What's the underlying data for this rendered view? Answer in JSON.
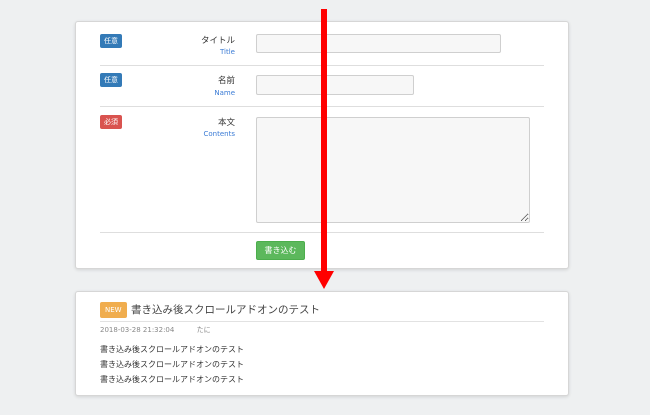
{
  "form": {
    "fields": [
      {
        "badge": "任意",
        "label": "タイトル",
        "label_en": "Title",
        "value": ""
      },
      {
        "badge": "任意",
        "label": "名前",
        "label_en": "Name",
        "value": ""
      },
      {
        "badge": "必須",
        "label": "本文",
        "label_en": "Contents",
        "value": ""
      }
    ],
    "submit_label": "書き込む"
  },
  "post": {
    "badge": "NEW",
    "title": "書き込み後スクロールアドオンのテスト",
    "date": "2018-03-28 21:32:04",
    "author": "たに",
    "lines": [
      "書き込み後スクロールアドオンのテスト",
      "書き込み後スクロールアドオンのテスト",
      "書き込み後スクロールアドオンのテスト"
    ]
  },
  "colors": {
    "arrow": "#ff0000",
    "optional_badge": "#337ab7",
    "required_badge": "#d9534f",
    "submit": "#5cb85c",
    "new_badge": "#f0ad4e"
  }
}
